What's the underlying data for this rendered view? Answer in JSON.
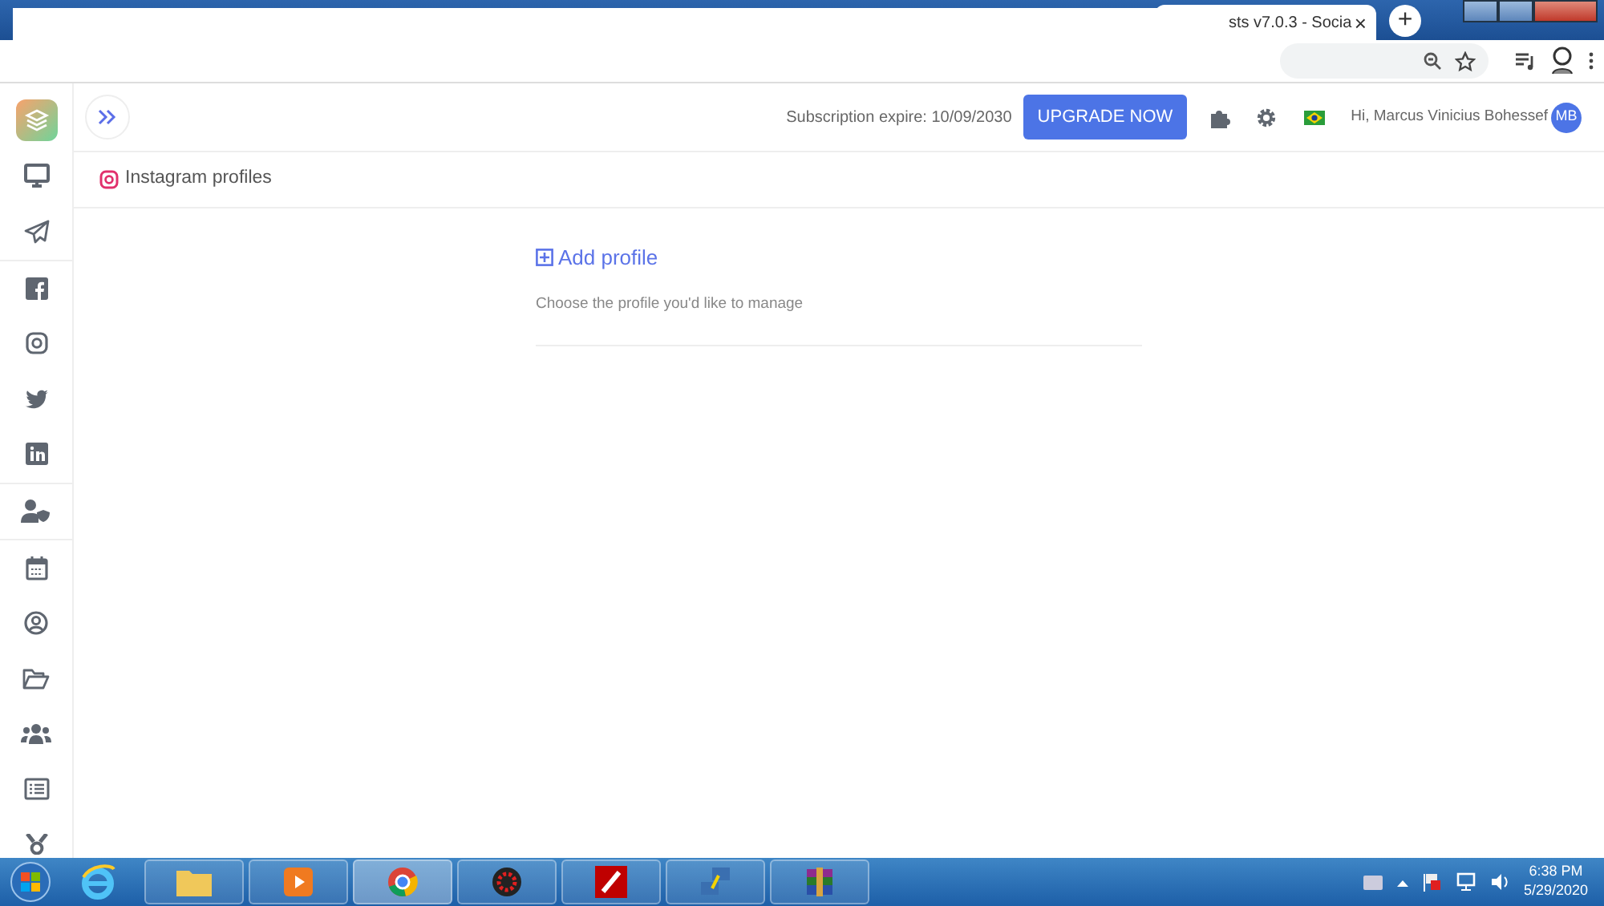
{
  "browser": {
    "tab_title": "sts v7.0.3 - Socia",
    "tab_close": "×",
    "new_tab": "+"
  },
  "header": {
    "subscription": "Subscription expire: 10/09/2030",
    "upgrade_button": "UPGRADE NOW",
    "greeting": "Hi, Marcus Vinicius Bohessef",
    "avatar": "MB"
  },
  "page_title": "Instagram profiles",
  "add_profile": {
    "label": "Add profile",
    "hint": "Choose the profile you'd like to manage"
  },
  "taskbar": {
    "time": "6:38 PM",
    "date": "5/29/2020"
  }
}
